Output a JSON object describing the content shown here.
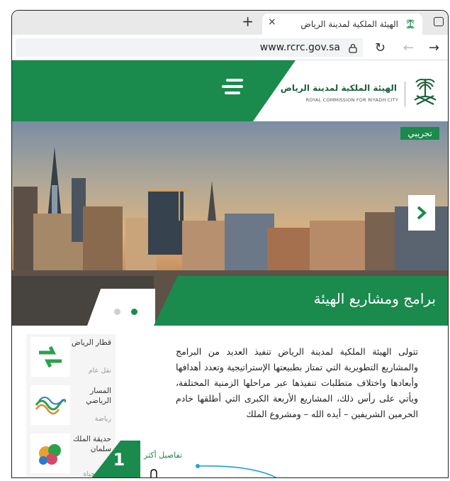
{
  "browser": {
    "tab_title": "الهيئة الملكية لمدينة الرياض",
    "tab_close": "×",
    "new_tab": "+",
    "url": "www.rcrc.gov.sa"
  },
  "site": {
    "brand_ar": "الهيئة الملكية لمدينة الرياض",
    "brand_en": "ROYAL COMMISSION FOR RIYADH CITY",
    "tag": "تجريبي",
    "hero_title": "برامج ومشاريع الهيئة",
    "body_text": "تتولى الهيئة الملكية لمدينة الرياض تنفيذ العديد من البرامج والمشاريع التطويرية التي تمتاز بطبيعتها الإستراتيجية وتعدد أهدافها وأبعادها واختلاف متطلبات تنفيذها عبر مراحلها الزمنية المختلفة، ويأتي على رأس ذلك، المشاريع الأربعة الكبرى التي أطلقها خادم الحرمين الشريفين – أيده الله – ومشروع الملك",
    "more_link": "تفاصيل أكثر",
    "badge": "1"
  },
  "sidebar": {
    "items": [
      {
        "title": "قطار الرياض",
        "subtitle": "نقل عام"
      },
      {
        "title": "المسار الرياضي",
        "subtitle": "رياضة"
      },
      {
        "title": "حديقة الملك سلمان",
        "subtitle": "جودة حياة"
      }
    ]
  },
  "colors": {
    "brand_green": "#1a8a4d",
    "accent_cyan": "#1ea3d8"
  }
}
